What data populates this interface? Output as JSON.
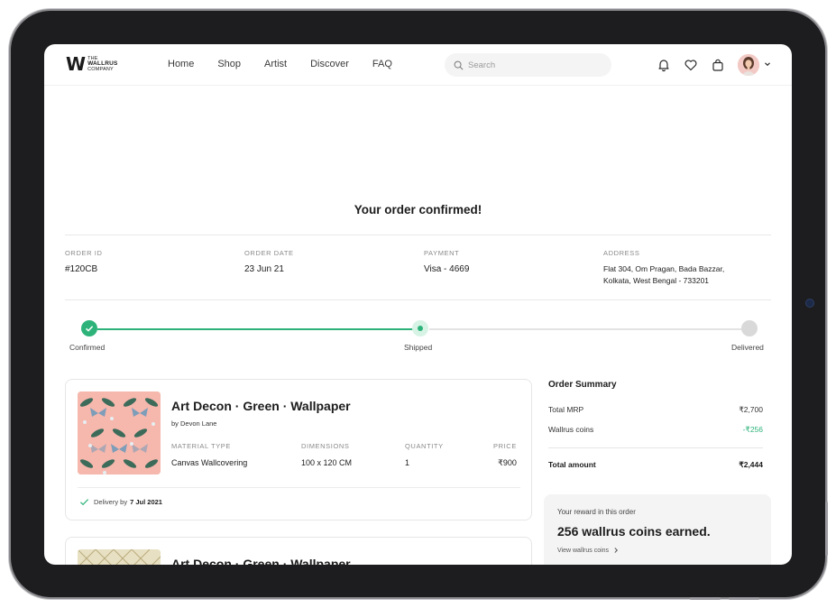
{
  "brand": {
    "logo_mark": "W",
    "logo_line1": "THE",
    "logo_line2": "WALLRUS",
    "logo_line3": "COMPANY"
  },
  "nav": [
    "Home",
    "Shop",
    "Artist",
    "Discover",
    "FAQ"
  ],
  "search": {
    "placeholder": "Search",
    "value": ""
  },
  "header_icons": [
    "bell-icon",
    "heart-icon",
    "bag-icon",
    "avatar",
    "chevron-down-icon"
  ],
  "page_title": "Your order confirmed!",
  "order_info": {
    "order_id_label": "ORDER ID",
    "order_id": "#120CB",
    "order_date_label": "ORDER DATE",
    "order_date": "23 Jun 21",
    "payment_label": "PAYMENT",
    "payment": "Visa - 4669",
    "address_label": "ADDRESS",
    "address_line1": "Flat 304, Om Pragan, Bada Bazzar,",
    "address_line2": "Kolkata, West Bengal - 733201"
  },
  "progress": {
    "steps": [
      "Confirmed",
      "Shipped",
      "Delivered"
    ],
    "states": [
      "done",
      "current",
      "pending"
    ]
  },
  "items": [
    {
      "name": "Art Decon · Green · Wallpaper",
      "artist": "by Devon Lane",
      "material_label": "MATERIAL TYPE",
      "material": "Canvas Wallcovering",
      "dimensions_label": "DIMENSIONS",
      "dimensions": "100 x 120 CM",
      "quantity_label": "QUANTITY",
      "quantity": "1",
      "price_label": "PRICE",
      "price": "₹900",
      "delivery_prefix": "Delivery by",
      "delivery_date": "7 Jul 2021"
    },
    {
      "name": "Art Decon · Green · Wallpaper"
    }
  ],
  "summary": {
    "title": "Order Summary",
    "total_mrp_label": "Total MRP",
    "total_mrp": "₹2,700",
    "coins_label": "Wallrus coins",
    "coins": "-₹256",
    "total_label": "Total amount",
    "total": "₹2,444"
  },
  "reward": {
    "label": "Your reward in this order",
    "headline": "256 wallrus coins earned.",
    "link": "View wallrus coins"
  },
  "colors": {
    "accent_green": "#2db37a",
    "pending_grey": "#d9d9d9",
    "frame": "#1d1d1f"
  }
}
